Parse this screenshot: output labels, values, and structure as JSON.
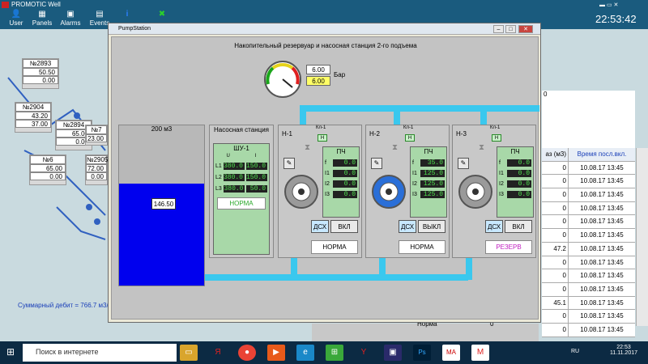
{
  "app": {
    "title": "PROMOTIC Well",
    "clock": "22:53:42"
  },
  "toolbar": [
    "User",
    "Panels",
    "Alarms",
    "Events"
  ],
  "wells": [
    {
      "id": "№2893",
      "v1": "50.50",
      "v2": "0.00"
    },
    {
      "id": "№2904",
      "v1": "43.20",
      "v2": "37.00"
    },
    {
      "id": "№2894",
      "v1": "65.00",
      "v2": "0.00"
    },
    {
      "id": "№6",
      "v1": "65.00",
      "v2": "0.00"
    },
    {
      "id": "№2905",
      "v1": "72.00",
      "v2": "0.00"
    },
    {
      "id": "№7",
      "v1": "23.00",
      "v2": ""
    }
  ],
  "total_flow": "Суммарный дебит = 766.7 м3/",
  "right_value": "0",
  "table": {
    "header": [
      "аз (м3)",
      "Время посл.вкл."
    ],
    "rows": [
      [
        "0",
        "10.08.17 13:45"
      ],
      [
        "0",
        "10.08.17 13:45"
      ],
      [
        "0",
        "10.08.17 13:45"
      ],
      [
        "0",
        "10.08.17 13:45"
      ],
      [
        "0",
        "10.08.17 13:45"
      ],
      [
        "0",
        "10.08.17 13:45"
      ],
      [
        "47.2",
        "10.08.17 13:45"
      ],
      [
        "0",
        "10.08.17 13:45"
      ],
      [
        "0",
        "10.08.17 13:45"
      ],
      [
        "0",
        "10.08.17 13:45"
      ],
      [
        "45.1",
        "10.08.17 13:45"
      ],
      [
        "0",
        "10.08.17 13:45"
      ],
      [
        "0",
        "10.08.17 13:45"
      ]
    ],
    "footer": [
      "Норма",
      "0"
    ]
  },
  "window": {
    "title": "PumpStation",
    "heading": "Накопительный резервуар и насосная станция 2-го подъема",
    "pressure": {
      "setpoint": "6.00",
      "actual": "6.00",
      "unit": "Бар"
    },
    "tank": {
      "capacity": "200 м3",
      "level": "146.50",
      "fill": 0.67
    },
    "station": {
      "label": "Насосная станция",
      "panel": "ШУ-1",
      "col_u": "U",
      "col_i": "I",
      "rows": [
        {
          "name": "L1",
          "u": "380.0",
          "i": "150.0"
        },
        {
          "name": "L2",
          "u": "380.0",
          "i": "150.0"
        },
        {
          "name": "L3",
          "u": "380.0",
          "i": "50.0"
        }
      ],
      "status": "НОРМА"
    },
    "pumps": [
      {
        "name": "Н-1",
        "valve": "Кл-1",
        "valve_state": "Н",
        "pch": "ПЧ",
        "f": "0.0",
        "i1": "0.0",
        "i2": "0.0",
        "i3": "0.0",
        "dsx": "ДСХ",
        "switch": "ВКЛ",
        "status": "НОРМА",
        "status_color": "#000"
      },
      {
        "name": "Н-2",
        "valve": "Кл-1",
        "valve_state": "Н",
        "pch": "ПЧ",
        "f": "35.0",
        "i1": "125.0",
        "i2": "125.0",
        "i3": "125.0",
        "dsx": "ДСХ",
        "switch": "ВЫКЛ",
        "status": "НОРМА",
        "status_color": "#000"
      },
      {
        "name": "Н-3",
        "valve": "Кл-1",
        "valve_state": "Н",
        "pch": "ПЧ",
        "f": "0.0",
        "i1": "0.0",
        "i2": "0.0",
        "i3": "0.0",
        "dsx": "ДСХ",
        "switch": "ВКЛ",
        "status": "РЕЗЕРВ",
        "status_color": "#c020c0"
      }
    ],
    "labels": {
      "f": "f",
      "i1": "I1",
      "i2": "I2",
      "i3": "I3"
    }
  },
  "taskbar": {
    "search": "Поиск в интернете",
    "lang": "RU",
    "time": "22:53",
    "date": "11.11.2017"
  },
  "colors": {
    "accent": "#1a5b7e",
    "pipe": "#3ac8ee",
    "tank": "#0000ee",
    "running": "#2a6fd8"
  }
}
